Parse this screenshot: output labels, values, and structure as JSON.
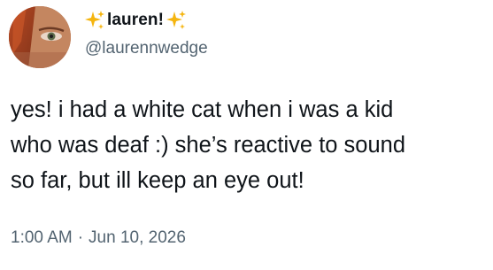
{
  "author": {
    "display_name": "lauren!",
    "handle": "@laurennwedge",
    "name_prefix_icon": "sparkles-icon",
    "name_suffix_icon": "sparkles-icon"
  },
  "tweet": {
    "text": "yes! i had a white cat when i was a kid\nwho was deaf :) she’s reactive to sound\nso far, but ill keep an eye out!",
    "time": "1:00 AM",
    "separator": "·",
    "date": "Jun 10, 2026"
  },
  "colors": {
    "text_primary": "#0f1419",
    "text_secondary": "#536471",
    "sparkle": "#f5b50f"
  }
}
